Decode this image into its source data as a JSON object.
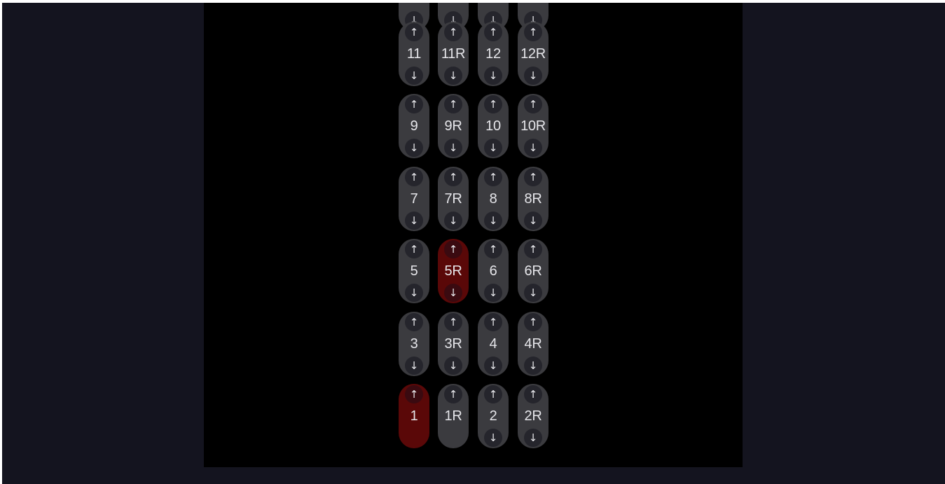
{
  "colors": {
    "page_background": "#14141f",
    "panel_background": "#000000",
    "floor_button": "#3b3b3f",
    "floor_button_active": "#5a0808",
    "arrow_button": "#25252c"
  },
  "icons": {
    "up": "↑",
    "down": "↓"
  },
  "elevator": {
    "top_partial_row": [
      {
        "label": "",
        "has_down": true
      },
      {
        "label": "",
        "has_down": true
      },
      {
        "label": "",
        "has_down": true
      },
      {
        "label": "",
        "has_down": true
      }
    ],
    "rows": [
      [
        {
          "label": "11",
          "active": false,
          "has_up": true,
          "has_down": true
        },
        {
          "label": "11R",
          "active": false,
          "has_up": true,
          "has_down": true
        },
        {
          "label": "12",
          "active": false,
          "has_up": true,
          "has_down": true
        },
        {
          "label": "12R",
          "active": false,
          "has_up": true,
          "has_down": true
        }
      ],
      [
        {
          "label": "9",
          "active": false,
          "has_up": true,
          "has_down": true
        },
        {
          "label": "9R",
          "active": false,
          "has_up": true,
          "has_down": true
        },
        {
          "label": "10",
          "active": false,
          "has_up": true,
          "has_down": true
        },
        {
          "label": "10R",
          "active": false,
          "has_up": true,
          "has_down": true
        }
      ],
      [
        {
          "label": "7",
          "active": false,
          "has_up": true,
          "has_down": true
        },
        {
          "label": "7R",
          "active": false,
          "has_up": true,
          "has_down": true
        },
        {
          "label": "8",
          "active": false,
          "has_up": true,
          "has_down": true
        },
        {
          "label": "8R",
          "active": false,
          "has_up": true,
          "has_down": true
        }
      ],
      [
        {
          "label": "5",
          "active": false,
          "has_up": true,
          "has_down": true
        },
        {
          "label": "5R",
          "active": true,
          "has_up": true,
          "has_down": true
        },
        {
          "label": "6",
          "active": false,
          "has_up": true,
          "has_down": true
        },
        {
          "label": "6R",
          "active": false,
          "has_up": true,
          "has_down": true
        }
      ],
      [
        {
          "label": "3",
          "active": false,
          "has_up": true,
          "has_down": true
        },
        {
          "label": "3R",
          "active": false,
          "has_up": true,
          "has_down": true
        },
        {
          "label": "4",
          "active": false,
          "has_up": true,
          "has_down": true
        },
        {
          "label": "4R",
          "active": false,
          "has_up": true,
          "has_down": true
        }
      ],
      [
        {
          "label": "1",
          "active": true,
          "has_up": true,
          "has_down": false
        },
        {
          "label": "1R",
          "active": false,
          "has_up": true,
          "has_down": false
        },
        {
          "label": "2",
          "active": false,
          "has_up": true,
          "has_down": true
        },
        {
          "label": "2R",
          "active": false,
          "has_up": true,
          "has_down": true
        }
      ]
    ]
  }
}
